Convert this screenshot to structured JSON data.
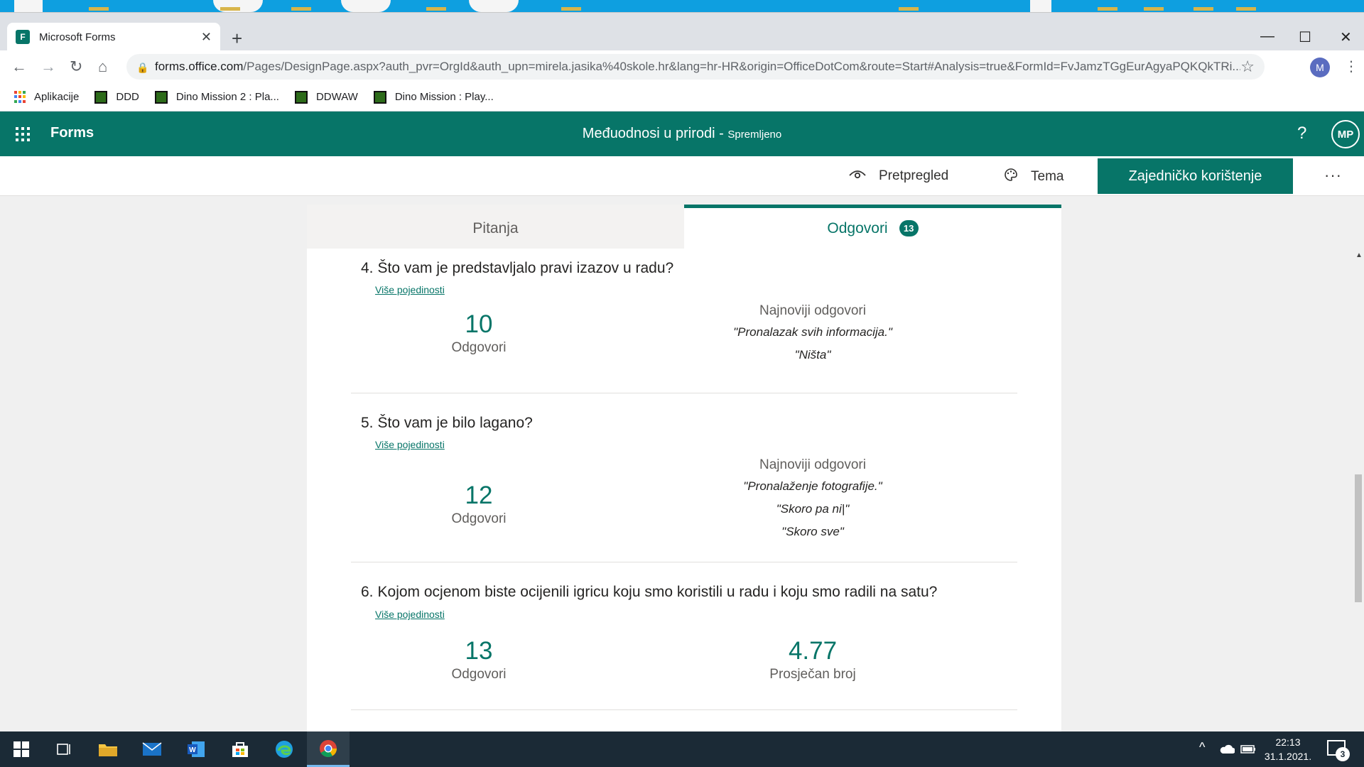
{
  "browser": {
    "tab_title": "Microsoft Forms",
    "url_host": "forms.office.com",
    "url_rest": "/Pages/DesignPage.aspx?auth_pvr=OrgId&auth_upn=mirela.jasika%40skole.hr&lang=hr-HR&origin=OfficeDotCom&route=Start#Analysis=true&FormId=FvJamzTGgEurAgyaPQKQkTRi...",
    "profile_initial": "M",
    "bookmarks": [
      {
        "label": "Aplikacije",
        "icon": "apps-grid-icon"
      },
      {
        "label": "DDD",
        "icon": "game-icon"
      },
      {
        "label": "Dino Mission 2 : Pla...",
        "icon": "game-icon"
      },
      {
        "label": "DDWAW",
        "icon": "game-icon"
      },
      {
        "label": "Dino Mission : Play...",
        "icon": "game-icon"
      }
    ]
  },
  "header": {
    "brand": "Forms",
    "form_title": "Međuodnosi u prirodi",
    "separator": " - ",
    "save_status": "Spremljeno",
    "help": "?",
    "avatar_initials": "MP",
    "accent_color": "#077568"
  },
  "commands": {
    "preview": "Pretpregled",
    "theme": "Tema",
    "share": "Zajedničko korištenje",
    "more": "···"
  },
  "tabs": {
    "questions": "Pitanja",
    "responses": "Odgovori",
    "responses_count": "13"
  },
  "questions": [
    {
      "number": "4.",
      "title": "Što vam je predstavljalo pravi izazov u radu?",
      "link": "Više pojedinosti",
      "count": "10",
      "count_label": "Odgovori",
      "latest_header": "Najnoviji odgovori",
      "latest": [
        "\"Pronalazak svih informacija.\"",
        "\"Ništa\""
      ]
    },
    {
      "number": "5.",
      "title": "Što vam je bilo lagano?",
      "link": "Više pojedinosti",
      "count": "12",
      "count_label": "Odgovori",
      "latest_header": "Najnoviji odgovori",
      "latest": [
        "\"Pronalaženje fotografije.\"",
        "\"Skoro pa ni|\"",
        "\"Skoro sve\""
      ]
    },
    {
      "number": "6.",
      "title": "Kojom ocjenom biste ocijenili igricu koju smo koristili u radu i koju smo radili na satu?",
      "link": "Više pojedinosti",
      "count": "13",
      "count_label": "Odgovori",
      "average": "4.77",
      "average_label": "Prosječan broj"
    }
  ],
  "taskbar": {
    "time": "22:13",
    "date": "31.1.2021.",
    "notifications": "3"
  }
}
